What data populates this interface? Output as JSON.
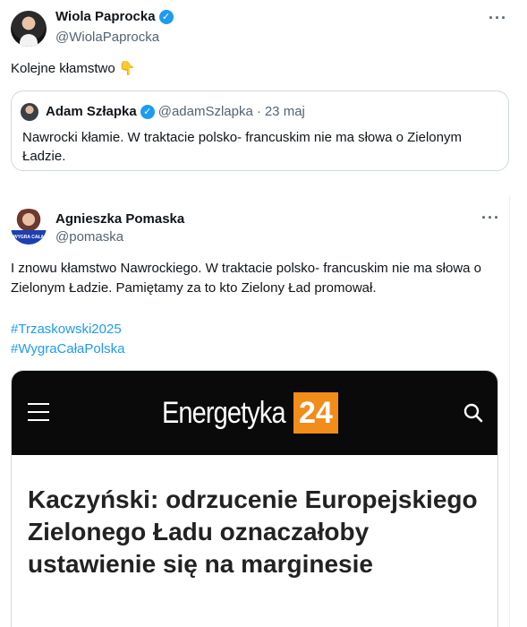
{
  "main_tweet": {
    "author_name": "Wiola Paprocka",
    "handle": "@WiolaPaprocka",
    "text": "Kolejne kłamstwo",
    "emoji": "👇",
    "more_label": "···"
  },
  "quoted_tweet": {
    "author_name": "Adam Szłapka",
    "handle": "@adamSzlapka",
    "separator": "·",
    "date": "23 maj",
    "text": "Nawrocki kłamie. W traktacie polsko- francuskim nie ma słowa o Zielonym Ładzie."
  },
  "second_tweet": {
    "author_name": "Agnieszka Pomaska",
    "handle": "@pomaska",
    "more_label": "···",
    "avatar_badge_text": "WYGRA CAŁA POLSKA",
    "text": "I znowu kłamstwo Nawrockiego. W traktacie polsko- francuskim nie ma słowa o Zielonym Ładzie. Pamiętamy za to kto Zielony Ład promował.",
    "hashtags": [
      "#Trzaskowski2025",
      "#WygraCałaPolska"
    ]
  },
  "link_card": {
    "brand_name": "Energetyka",
    "brand_number": "24",
    "headline": "Kaczyński: odrzucenie Europejskiego Zielonego Ładu oznaczałoby ustawienie się na marginesie"
  },
  "colors": {
    "verified_blue": "#1d9bf0",
    "hashtag_blue": "#1d9bf0",
    "brand_orange": "#f28c1b"
  }
}
